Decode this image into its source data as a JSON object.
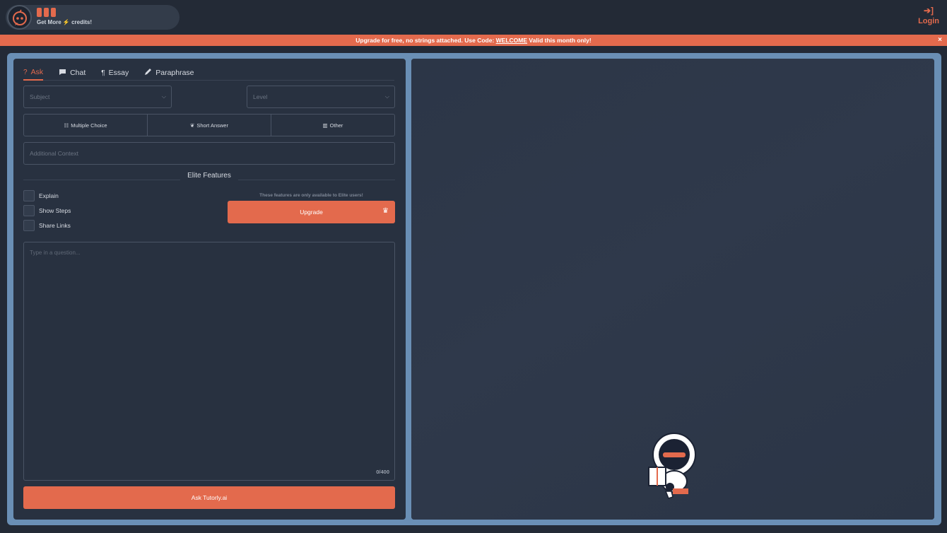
{
  "header": {
    "credits": {
      "filled_bars": 3,
      "get_more_prefix": "Get More",
      "get_more_suffix": "credits!"
    },
    "login_label": "Login"
  },
  "banner": {
    "text_before": "Upgrade for free, no strings attached. Use Code:",
    "code": "WELCOME",
    "text_after": "Valid this month only!",
    "close": "×"
  },
  "tabs": [
    {
      "label": "Ask",
      "icon": "question-icon",
      "active": true
    },
    {
      "label": "Chat",
      "icon": "chat-bubble-icon",
      "active": false
    },
    {
      "label": "Essay",
      "icon": "paragraph-icon",
      "active": false
    },
    {
      "label": "Paraphrase",
      "icon": "pencil-icon",
      "active": false
    }
  ],
  "form": {
    "subject_placeholder": "Subject",
    "level_placeholder": "Level",
    "question_types": [
      {
        "label": "Multiple Choice",
        "icon": "list-icon"
      },
      {
        "label": "Short Answer",
        "icon": "brain-icon"
      },
      {
        "label": "Other",
        "icon": "books-icon"
      }
    ],
    "context_placeholder": "Additional Context",
    "elite_title": "Elite Features",
    "options": [
      "Explain",
      "Show Steps",
      "Share Links"
    ],
    "elite_note": "These features are only available to Elite users!",
    "upgrade_label": "Upgrade",
    "question_placeholder": "Type in a question...",
    "char_count": "0/400",
    "ask_label": "Ask Tutorly.ai"
  },
  "colors": {
    "accent": "#e36a4d",
    "frame": "#6a8fb5",
    "panel": "#283140",
    "background": "#232a36"
  }
}
